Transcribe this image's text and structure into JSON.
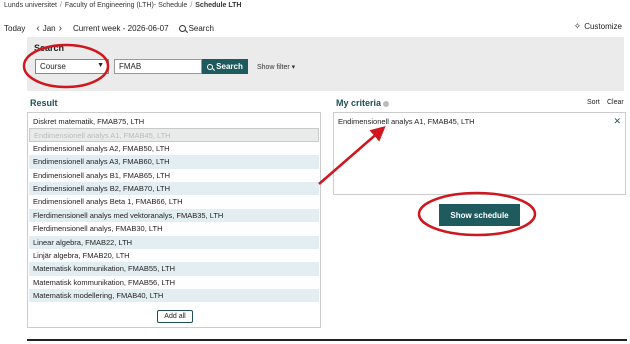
{
  "breadcrumb": {
    "items": [
      "Lunds universitet",
      "Faculty of Engineering (LTH)- Schedule",
      "Schedule LTH"
    ]
  },
  "toolbar": {
    "today": "Today",
    "period": "Jan",
    "week_label": "Current week - 2026-06-07",
    "search_label": "Search",
    "customize_label": "Customize"
  },
  "search": {
    "title": "Search",
    "type_value": "Course",
    "query_value": "FMAB",
    "button_label": "Search",
    "show_filter": "Show filter"
  },
  "result": {
    "title": "Result",
    "items": [
      "Diskret matematik, FMAB75, LTH",
      "Endimensionell analys A1, FMAB45, LTH",
      "Endimensionell analys A2, FMAB50, LTH",
      "Endimensionell analys A3, FMAB60, LTH",
      "Endimensionell analys B1, FMAB65, LTH",
      "Endimensionell analys B2, FMAB70, LTH",
      "Endimensionell analys Beta 1, FMAB66, LTH",
      "Flerdimensionell analys med vektoranalys, FMAB35, LTH",
      "Flerdimensionell analys, FMAB30, LTH",
      "Linear algebra, FMAB22, LTH",
      "Linjär algebra, FMAB20, LTH",
      "Matematisk kommunikation, FMAB55, LTH",
      "Matematisk kommunikation, FMAB56, LTH",
      "Matematisk modellering, FMAB40, LTH"
    ],
    "add_all_label": "Add all"
  },
  "criteria": {
    "title": "My criteria",
    "sort_label": "Sort",
    "clear_label": "Clear",
    "items": [
      "Endimensionell analys A1, FMAB45, LTH"
    ],
    "remove_icon": "close-icon"
  },
  "show_schedule_label": "Show schedule",
  "colors": {
    "accent": "#1f5a5f",
    "annotation_red": "#d0161e",
    "row_stripe": "#e3eef2"
  }
}
